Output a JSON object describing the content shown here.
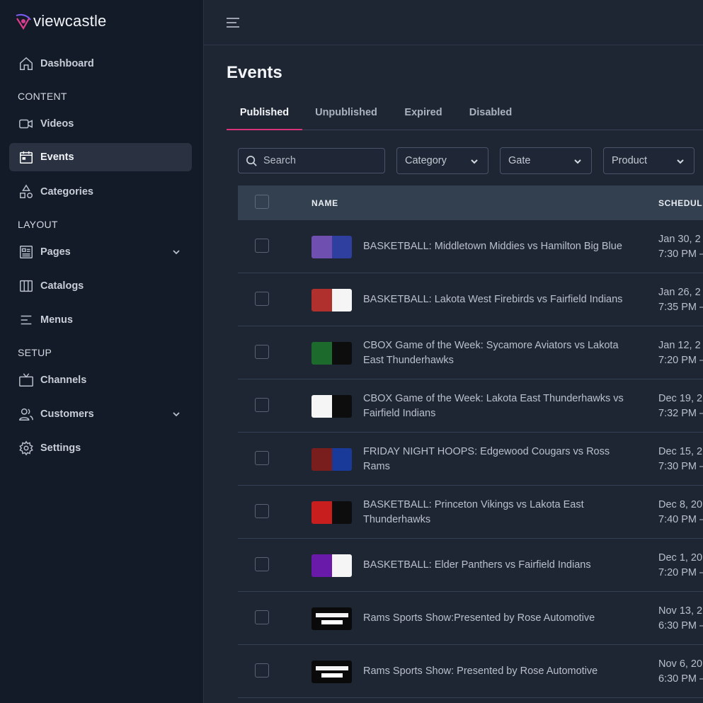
{
  "brand": {
    "name": "viewcastle"
  },
  "sidebar": {
    "items": [
      {
        "label": "Dashboard",
        "icon": "home-icon"
      },
      {
        "section": "CONTENT"
      },
      {
        "label": "Videos",
        "icon": "video-camera-icon"
      },
      {
        "label": "Events",
        "icon": "calendar-icon",
        "active": true
      },
      {
        "label": "Categories",
        "icon": "shapes-icon"
      },
      {
        "section": "LAYOUT"
      },
      {
        "label": "Pages",
        "icon": "newspaper-icon",
        "expandable": true
      },
      {
        "label": "Catalogs",
        "icon": "columns-icon"
      },
      {
        "label": "Menus",
        "icon": "menu-lines-icon"
      },
      {
        "section": "SETUP"
      },
      {
        "label": "Channels",
        "icon": "tv-icon"
      },
      {
        "label": "Customers",
        "icon": "users-icon",
        "expandable": true
      },
      {
        "label": "Settings",
        "icon": "gear-icon"
      }
    ]
  },
  "page": {
    "title": "Events"
  },
  "tabs": [
    "Published",
    "Unpublished",
    "Expired",
    "Disabled"
  ],
  "filters": {
    "search_placeholder": "Search",
    "category": "Category",
    "gate": "Gate",
    "product": "Product"
  },
  "table": {
    "columns": [
      "NAME",
      "SCHEDULI"
    ],
    "rows": [
      {
        "name": "BASKETBALL: Middletown Middies vs Hamilton Big Blue",
        "date": "Jan 30, 2",
        "time": "7:30 PM –",
        "left": "#6f4fb0",
        "right": "#2f3fa0"
      },
      {
        "name": "BASKETBALL: Lakota West Firebirds vs Fairfield Indians",
        "date": "Jan 26, 2",
        "time": "7:35 PM –",
        "left": "#b0302e",
        "right": "#f5f5f5"
      },
      {
        "name": "CBOX Game of the Week: Sycamore Aviators vs Lakota East Thunderhawks",
        "date": "Jan 12, 2",
        "time": "7:20 PM –",
        "left": "#1c6a2c",
        "right": "#0d0d0d"
      },
      {
        "name": "CBOX Game of the Week: Lakota East Thunderhawks vs Fairfield Indians",
        "date": "Dec 19, 2",
        "time": "7:32 PM –",
        "left": "#f5f5f5",
        "right": "#0d0d0d"
      },
      {
        "name": "FRIDAY NIGHT HOOPS: Edgewood Cougars vs Ross Rams",
        "date": "Dec 15, 2",
        "time": "7:30 PM –",
        "left": "#7a1d1d",
        "right": "#1a3a9a"
      },
      {
        "name": "BASKETBALL: Princeton Vikings vs Lakota East Thunderhawks",
        "date": "Dec 8, 20",
        "time": "7:40 PM –",
        "left": "#c81e1e",
        "right": "#0d0d0d"
      },
      {
        "name": "BASKETBALL: Elder Panthers vs Fairfield Indians",
        "date": "Dec 1, 20",
        "time": "7:20 PM –",
        "left": "#6a1aa8",
        "right": "#f5f5f5"
      },
      {
        "name": "Rams Sports Show:Presented by Rose Automotive",
        "date": "Nov 13, 2",
        "time": "6:30 PM –",
        "wide": true
      },
      {
        "name": "Rams Sports Show: Presented by Rose Automotive",
        "date": "Nov 6, 20",
        "time": "6:30 PM –",
        "wide": true
      }
    ]
  }
}
